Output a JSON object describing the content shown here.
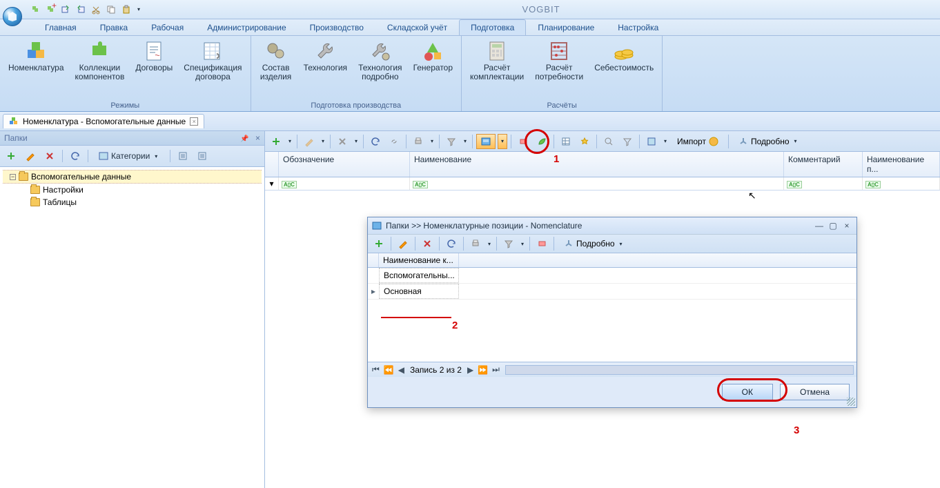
{
  "app_title": "VOGBIT",
  "tabs": {
    "t0": "Главная",
    "t1": "Правка",
    "t2": "Рабочая",
    "t3": "Администрирование",
    "t4": "Производство",
    "t5": "Складской учёт",
    "t6": "Подготовка",
    "t7": "Планирование",
    "t8": "Настройка"
  },
  "ribbon": {
    "g0": {
      "label": "Режимы",
      "b0": "Номенклатура",
      "b1_l1": "Коллекции",
      "b1_l2": "компонентов",
      "b2": "Договоры",
      "b3_l1": "Спецификация",
      "b3_l2": "договора"
    },
    "g1": {
      "label": "Подготовка производства",
      "b0_l1": "Состав",
      "b0_l2": "изделия",
      "b1": "Технология",
      "b2_l1": "Технология",
      "b2_l2": "подробно",
      "b3": "Генератор"
    },
    "g2": {
      "label": "Расчёты",
      "b0_l1": "Расчёт",
      "b0_l2": "комплектации",
      "b1_l1": "Расчёт",
      "b1_l2": "потребности",
      "b2": "Себестоимость"
    }
  },
  "doctab": {
    "title": "Номенклатура - Вспомогательные данные"
  },
  "sidebar": {
    "title": "Папки",
    "categories_btn": "Категории",
    "tree": {
      "root": "Вспомогательные данные",
      "n0": "Настройки",
      "n1": "Таблицы"
    }
  },
  "grid": {
    "toolbar": {
      "import": "Импорт",
      "details": "Подробно"
    },
    "cols": {
      "c0": "Обозначение",
      "c1": "Наименование",
      "c2": "Комментарий",
      "c3": "Наименование п..."
    }
  },
  "dialog": {
    "title": "Папки >> Номенклатурные позиции - Nomenclature",
    "toolbar": {
      "details": "Подробно"
    },
    "col0": "Наименование к...",
    "rows": {
      "r0": "Вспомогательны...",
      "r1": "Основная"
    },
    "nav": "Запись 2 из 2",
    "ok": "ОК",
    "cancel": "Отмена"
  },
  "annotations": {
    "n1": "1",
    "n2": "2",
    "n3": "3"
  }
}
